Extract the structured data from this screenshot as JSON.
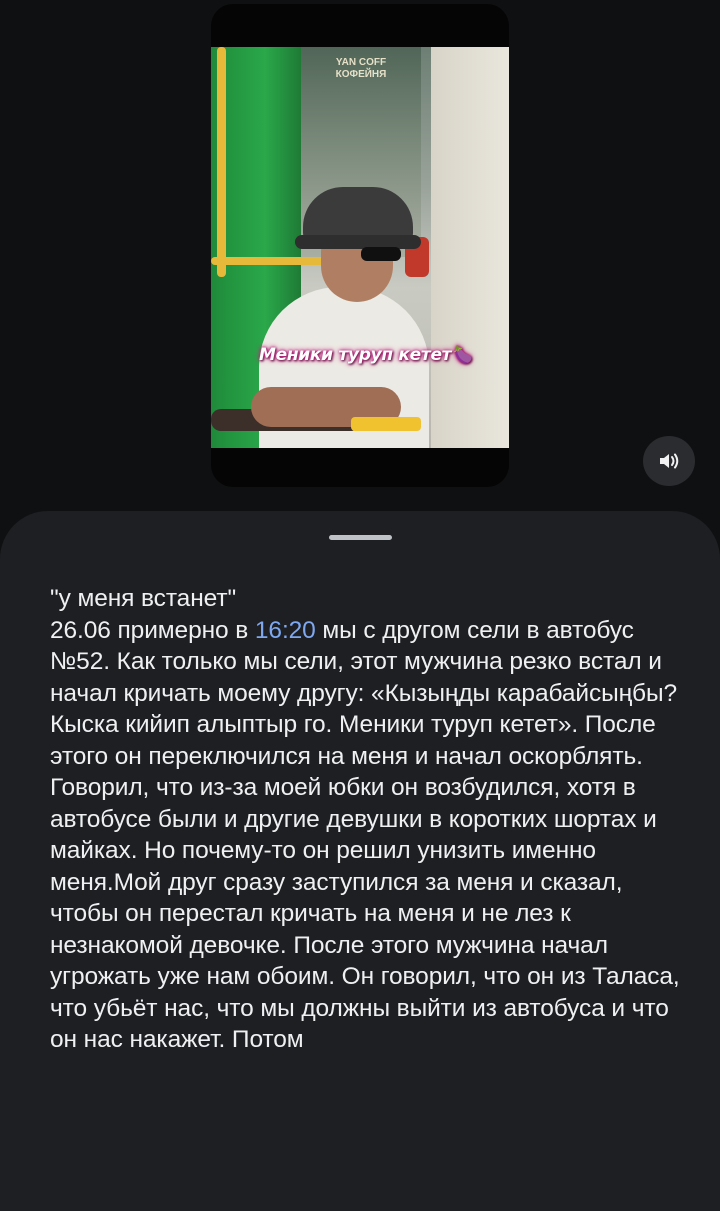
{
  "video": {
    "caption": "Меники туруп кетет🍆",
    "store_sign": "YAN COFF\nКОФЕЙНЯ"
  },
  "controls": {
    "volume_icon": "volume-icon"
  },
  "post": {
    "title_line": "\"у меня встанет\"",
    "date_prefix": "26.06 примерно в ",
    "time": "16:20",
    "body": " мы с другом сели в автобус №52. Как только мы сели, этот мужчина резко встал и начал кричать моему другу: «Кызыңды карабайсыңбы? Кыска кийип алыптыр го. Меники туруп кетет». После этого он переключился на меня и начал оскорблять. Говорил, что из-за моей юбки он возбудился, хотя в автобусе были и другие девушки в коротких шортах и майках. Но почему-то он решил унизить именно меня.Мой друг сразу заступился за меня и сказал, чтобы он перестал кричать на меня и не лез к незнакомой девочке. После этого мужчина начал угрожать уже нам обоим. Он говорил, что он из Таласа, что убьёт нас, что мы должны выйти из автобуса и что он нас накажет. Потом"
  },
  "colors": {
    "background": "#0f1012",
    "sheet": "#1d1f22",
    "link": "#7fa8f0",
    "text": "#eef0f2"
  }
}
